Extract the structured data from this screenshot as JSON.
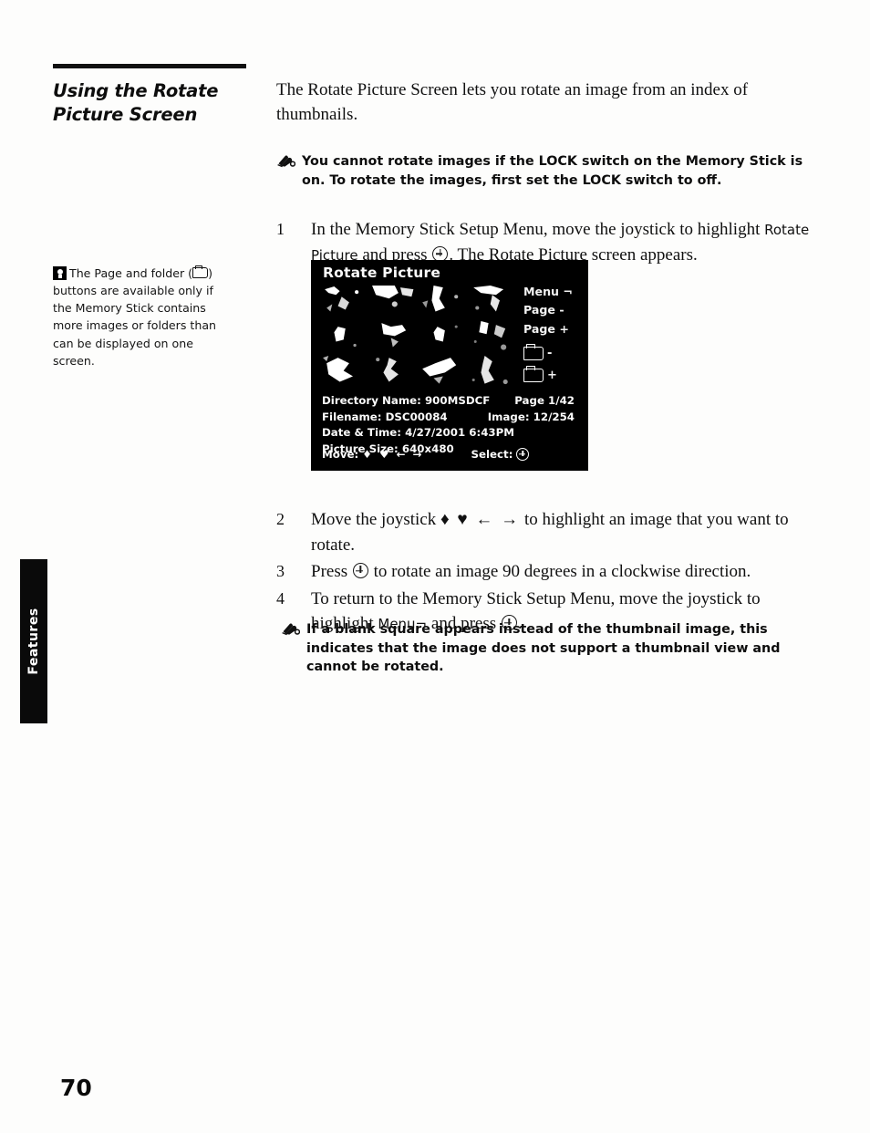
{
  "section": {
    "heading_line1": "Using the Rotate",
    "heading_line2": "Picture Screen"
  },
  "intro": {
    "text": "The Rotate Picture Screen lets you rotate an image from an index of thumbnails."
  },
  "notes": [
    {
      "icon": "pointing-hand-icon",
      "text": "You cannot rotate images if the LOCK switch on the Memory Stick is on. To rotate the images, first set the LOCK switch to off."
    },
    {
      "icon": "pointing-hand-icon",
      "text": "If a blank square appears instead of the thumbnail image, this indicates that the image does not support a thumbnail view and cannot be rotated."
    }
  ],
  "sidebar_tip": {
    "icon": "lightbulb-icon",
    "text_before_folder": "The Page and folder (",
    "text_after_folder": ") buttons are available only if the Memory Stick contains more images or folders than can be displayed on one screen."
  },
  "steps": [
    {
      "number": "1",
      "part1": "In the Memory Stick Setup Menu, move the joystick to highlight ",
      "ui_term": "Rotate Picture",
      "part2": " and press ",
      "part3": ". The Rotate Picture screen appears."
    },
    {
      "number": "2",
      "part1": "Move the joystick ",
      "arrows": "♦ ♥ ← →",
      "part2": " to highlight an image that you want to rotate."
    },
    {
      "number": "3",
      "part1": "Press ",
      "part2": " to rotate an image 90 degrees in a clockwise direction."
    },
    {
      "number": "4",
      "part1": "To return to the Memory Stick Setup Menu, move the joystick to highlight ",
      "ui_term": "Menu¬",
      "part2": " and press ",
      "part3": "."
    }
  ],
  "screen": {
    "title": "Rotate Picture",
    "buttons": [
      {
        "label": "Menu ¬"
      },
      {
        "label": "Page -"
      },
      {
        "label": "Page +"
      }
    ],
    "folder_buttons": [
      {
        "icon": "folder-icon",
        "sign": "-"
      },
      {
        "icon": "folder-icon",
        "sign": "+"
      }
    ],
    "info": [
      {
        "left": "Directory Name: 900MSDCF",
        "right": "Page 1/42"
      },
      {
        "left": "Filename: DSC00084",
        "right": "Image: 12/254"
      },
      {
        "left": "Date & Time: 4/27/2001 6:43PM",
        "right": ""
      },
      {
        "left": "Picture Size: 640x480",
        "right": ""
      }
    ],
    "hint_move_label": "Move:",
    "hint_move_arrows": "♦ ♥ ← →",
    "hint_select_label": "Select:",
    "thumbnail_count": 12,
    "colors": {
      "background": "#000000",
      "text": "#ffffff"
    }
  },
  "edge_tab": {
    "label": "Features"
  },
  "page_number": "70"
}
